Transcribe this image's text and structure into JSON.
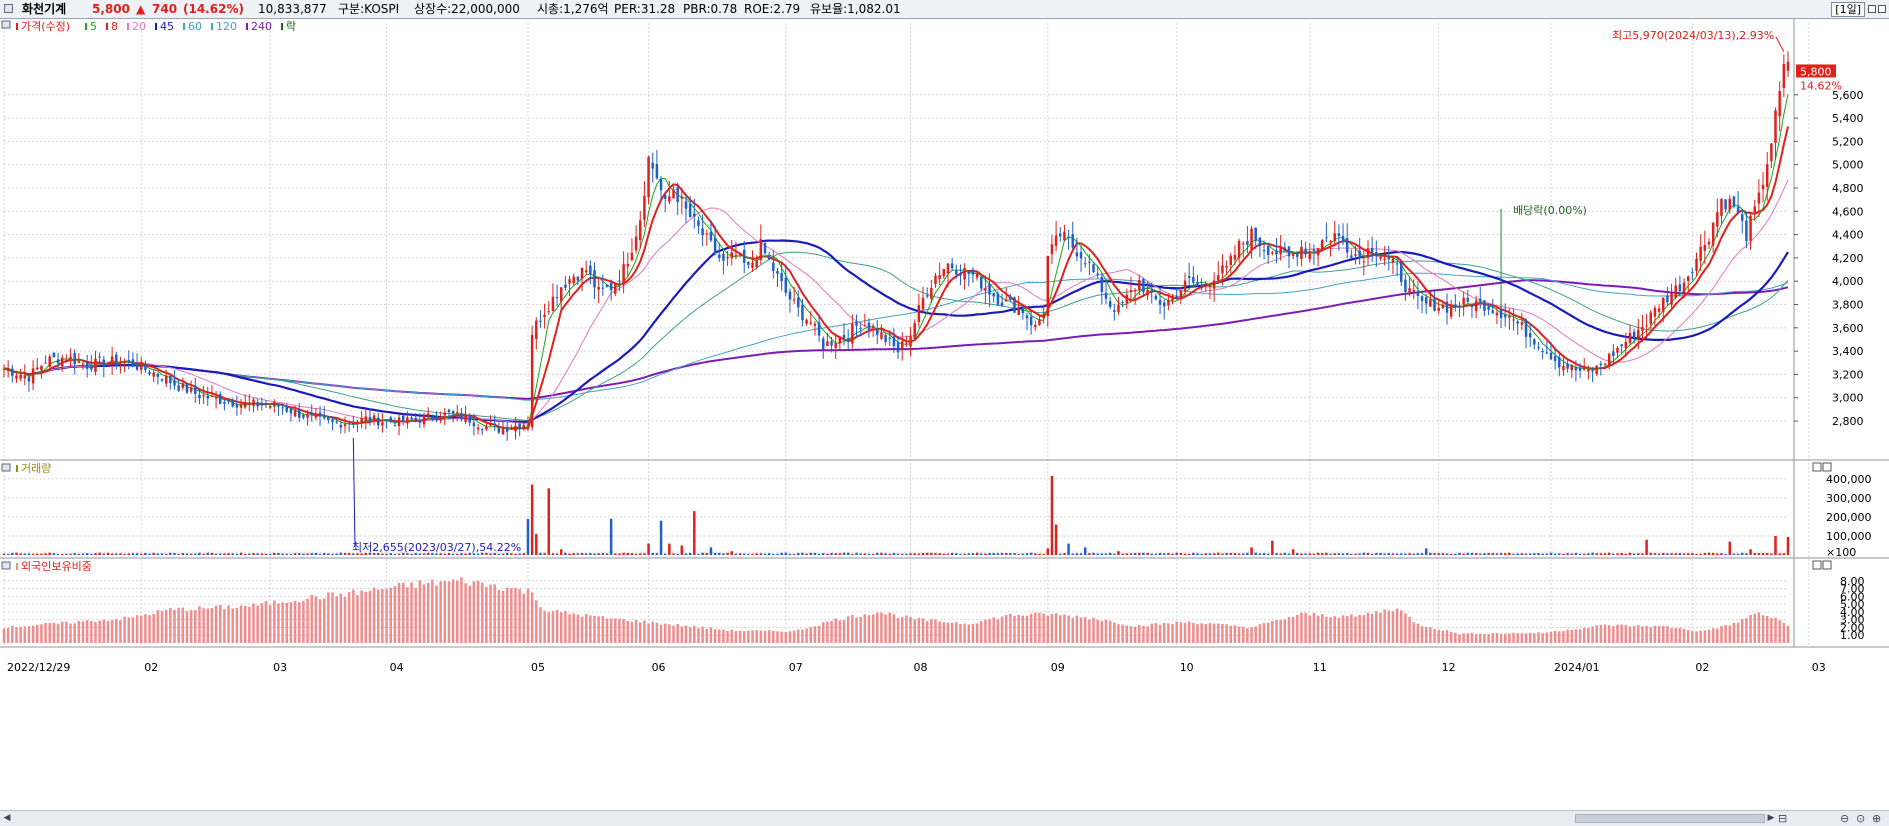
{
  "header": {
    "stock_name": "화천기계",
    "price": "5,800",
    "change_arrow": "▲",
    "change": "740",
    "change_pct": "(14.62%)",
    "volume": "10,833,877",
    "market": "구분:KOSPI",
    "shares": "상장수:22,000,000",
    "market_cap": "시총:1,276억",
    "per": "PER:31.28",
    "pbr": "PBR:0.78",
    "roe": "ROE:2.79",
    "reserve": "유보율:1,082.01",
    "period": "[1일]"
  },
  "legend": {
    "price_label": "가격(수정)",
    "ma": [
      {
        "label": "5",
        "color": "#1aa51a"
      },
      {
        "label": "8",
        "color": "#e0201b"
      },
      {
        "label": "20",
        "color": "#e079c4"
      },
      {
        "label": "45",
        "color": "#1b1bbb"
      },
      {
        "label": "60",
        "color": "#41a3c8"
      },
      {
        "label": "120",
        "color": "#41a3c8"
      },
      {
        "label": "240",
        "color": "#7f1bb5"
      }
    ],
    "ex_div_label": "락"
  },
  "panels": {
    "volume_title": "거래량",
    "foreign_title": "외국인보유비중"
  },
  "colors": {
    "up": "#e0201b",
    "down": "#1e5fcc",
    "grid": "#d6d6d6",
    "foreign_bar": "#f18c8c"
  },
  "chart_data": [
    {
      "type": "candlestick",
      "title": "가격(수정)",
      "ylim": [
        2500,
        6130
      ],
      "price_ticks": [
        "2,800",
        "3,000",
        "3,200",
        "3,400",
        "3,600",
        "3,800",
        "4,000",
        "4,200",
        "4,400",
        "4,600",
        "4,800",
        "5,000",
        "5,200",
        "5,400",
        "5,600"
      ],
      "price_tick_values": [
        2800,
        3000,
        3200,
        3400,
        3600,
        3800,
        4000,
        4200,
        4400,
        4600,
        4800,
        5000,
        5200,
        5400,
        5600
      ],
      "date_labels": [
        "2022/12/29",
        "02",
        "03",
        "04",
        "05",
        "06",
        "07",
        "08",
        "09",
        "10",
        "11",
        "12",
        "2024/01",
        "02",
        "03"
      ],
      "date_label_days": [
        0,
        33,
        64,
        92,
        126,
        155,
        188,
        218,
        251,
        282,
        314,
        345,
        372,
        406,
        434
      ],
      "annotations": {
        "high": "최고5,970(2024/03/13),2.93%",
        "low": "최저2,655(2023/03/27),54.22%",
        "ex_dividend": "배당락(0.00%)",
        "current_price_label": "5,800",
        "current_pct_label": "14.62%"
      },
      "current_price": 5800,
      "high_value": 5970,
      "low_value": 2655,
      "close_series": [
        [
          0,
          3250
        ],
        [
          6,
          3180
        ],
        [
          10,
          3320
        ],
        [
          15,
          3350
        ],
        [
          20,
          3280
        ],
        [
          25,
          3310
        ],
        [
          30,
          3300
        ],
        [
          33,
          3260
        ],
        [
          38,
          3180
        ],
        [
          42,
          3100
        ],
        [
          47,
          3020
        ],
        [
          52,
          2980
        ],
        [
          57,
          2950
        ],
        [
          62,
          2940
        ],
        [
          66,
          2930
        ],
        [
          71,
          2860
        ],
        [
          75,
          2810
        ],
        [
          79,
          2780
        ],
        [
          83,
          2790
        ],
        [
          87,
          2820
        ],
        [
          91,
          2800
        ],
        [
          95,
          2790
        ],
        [
          99,
          2810
        ],
        [
          103,
          2840
        ],
        [
          107,
          2860
        ],
        [
          111,
          2830
        ],
        [
          115,
          2760
        ],
        [
          119,
          2730
        ],
        [
          123,
          2760
        ],
        [
          126,
          2790
        ],
        [
          127,
          3560
        ],
        [
          129,
          3700
        ],
        [
          131,
          3800
        ],
        [
          134,
          3960
        ],
        [
          137,
          4050
        ],
        [
          140,
          4100
        ],
        [
          143,
          3900
        ],
        [
          146,
          3950
        ],
        [
          149,
          4100
        ],
        [
          151,
          4300
        ],
        [
          153,
          4550
        ],
        [
          155,
          5050
        ],
        [
          157,
          4900
        ],
        [
          159,
          4650
        ],
        [
          161,
          4800
        ],
        [
          164,
          4600
        ],
        [
          167,
          4450
        ],
        [
          170,
          4300
        ],
        [
          173,
          4150
        ],
        [
          176,
          4220
        ],
        [
          179,
          4100
        ],
        [
          182,
          4300
        ],
        [
          185,
          4100
        ],
        [
          188,
          3900
        ],
        [
          191,
          3750
        ],
        [
          194,
          3650
        ],
        [
          197,
          3450
        ],
        [
          200,
          3500
        ],
        [
          203,
          3550
        ],
        [
          206,
          3650
        ],
        [
          209,
          3600
        ],
        [
          212,
          3500
        ],
        [
          215,
          3400
        ],
        [
          218,
          3550
        ],
        [
          221,
          3850
        ],
        [
          224,
          4050
        ],
        [
          227,
          4150
        ],
        [
          230,
          4100
        ],
        [
          233,
          4050
        ],
        [
          236,
          3950
        ],
        [
          239,
          3850
        ],
        [
          242,
          3800
        ],
        [
          245,
          3750
        ],
        [
          248,
          3600
        ],
        [
          250,
          3750
        ],
        [
          251,
          4200
        ],
        [
          254,
          4400
        ],
        [
          257,
          4300
        ],
        [
          260,
          4200
        ],
        [
          263,
          4000
        ],
        [
          266,
          3800
        ],
        [
          268,
          3750
        ],
        [
          270,
          3850
        ],
        [
          273,
          4000
        ],
        [
          276,
          3850
        ],
        [
          279,
          3800
        ],
        [
          282,
          3900
        ],
        [
          285,
          4000
        ],
        [
          288,
          3950
        ],
        [
          291,
          4050
        ],
        [
          294,
          4100
        ],
        [
          297,
          4300
        ],
        [
          300,
          4400
        ],
        [
          303,
          4300
        ],
        [
          306,
          4250
        ],
        [
          309,
          4200
        ],
        [
          312,
          4300
        ],
        [
          314,
          4250
        ],
        [
          317,
          4350
        ],
        [
          320,
          4400
        ],
        [
          323,
          4300
        ],
        [
          326,
          4200
        ],
        [
          329,
          4300
        ],
        [
          332,
          4200
        ],
        [
          335,
          4100
        ],
        [
          338,
          3900
        ],
        [
          341,
          3800
        ],
        [
          344,
          3800
        ],
        [
          347,
          3780
        ],
        [
          350,
          3800
        ],
        [
          353,
          3820
        ],
        [
          356,
          3800
        ],
        [
          359,
          3750
        ],
        [
          362,
          3700
        ],
        [
          365,
          3600
        ],
        [
          368,
          3500
        ],
        [
          371,
          3400
        ],
        [
          374,
          3300
        ],
        [
          377,
          3250
        ],
        [
          380,
          3220
        ],
        [
          383,
          3250
        ],
        [
          386,
          3350
        ],
        [
          389,
          3450
        ],
        [
          392,
          3550
        ],
        [
          395,
          3650
        ],
        [
          398,
          3800
        ],
        [
          401,
          3900
        ],
        [
          404,
          4000
        ],
        [
          407,
          4200
        ],
        [
          410,
          4400
        ],
        [
          413,
          4700
        ],
        [
          416,
          4650
        ],
        [
          419,
          4400
        ],
        [
          422,
          4700
        ],
        [
          425,
          5200
        ],
        [
          428,
          5800
        ],
        [
          429,
          5900
        ]
      ]
    },
    {
      "type": "bar",
      "title": "거래량",
      "ylim": [
        0,
        420000
      ],
      "tick_labels": [
        "400,000",
        "300,000",
        "200,000",
        "100,000",
        "×100"
      ],
      "tick_values": [
        400000,
        300000,
        200000,
        100000,
        15000
      ],
      "peaks": [
        [
          126,
          190000
        ],
        [
          127,
          370000
        ],
        [
          128,
          110000
        ],
        [
          131,
          350000
        ],
        [
          134,
          30000
        ],
        [
          146,
          190000
        ],
        [
          155,
          60000
        ],
        [
          158,
          180000
        ],
        [
          160,
          60000
        ],
        [
          163,
          50000
        ],
        [
          166,
          230000
        ],
        [
          170,
          40000
        ],
        [
          175,
          20000
        ],
        [
          251,
          35000
        ],
        [
          252,
          415000
        ],
        [
          253,
          160000
        ],
        [
          256,
          60000
        ],
        [
          260,
          40000
        ],
        [
          268,
          20000
        ],
        [
          300,
          40000
        ],
        [
          305,
          75000
        ],
        [
          310,
          30000
        ],
        [
          342,
          35000
        ],
        [
          395,
          80000
        ],
        [
          415,
          70000
        ],
        [
          420,
          30000
        ],
        [
          426,
          100000
        ],
        [
          429,
          95000
        ]
      ]
    },
    {
      "type": "bar",
      "title": "외국인보유비중",
      "ylim": [
        0,
        9
      ],
      "tick_labels": [
        "8.00",
        "7.00",
        "6.00",
        "5.00",
        "4.00",
        "3.00",
        "2.00",
        "1.00"
      ],
      "tick_values": [
        8,
        7,
        6,
        5,
        4,
        3,
        2,
        1
      ],
      "profile": [
        [
          0,
          2.0
        ],
        [
          15,
          2.6
        ],
        [
          30,
          3.2
        ],
        [
          40,
          4.3
        ],
        [
          50,
          4.5
        ],
        [
          60,
          4.8
        ],
        [
          70,
          5.6
        ],
        [
          85,
          6.5
        ],
        [
          100,
          7.6
        ],
        [
          110,
          8.0
        ],
        [
          120,
          7.2
        ],
        [
          127,
          6.5
        ],
        [
          130,
          4.2
        ],
        [
          145,
          3.2
        ],
        [
          160,
          2.4
        ],
        [
          175,
          1.6
        ],
        [
          190,
          1.5
        ],
        [
          200,
          3.0
        ],
        [
          210,
          4.0
        ],
        [
          220,
          3.0
        ],
        [
          232,
          2.5
        ],
        [
          242,
          3.6
        ],
        [
          252,
          3.7
        ],
        [
          262,
          3.2
        ],
        [
          272,
          2.2
        ],
        [
          285,
          2.7
        ],
        [
          300,
          2.0
        ],
        [
          312,
          3.7
        ],
        [
          325,
          3.4
        ],
        [
          335,
          4.5
        ],
        [
          340,
          2.4
        ],
        [
          350,
          1.2
        ],
        [
          370,
          1.3
        ],
        [
          385,
          2.3
        ],
        [
          400,
          2.1
        ],
        [
          408,
          1.5
        ],
        [
          415,
          2.3
        ],
        [
          422,
          3.9
        ],
        [
          428,
          2.6
        ],
        [
          430,
          2.0
        ]
      ]
    }
  ]
}
